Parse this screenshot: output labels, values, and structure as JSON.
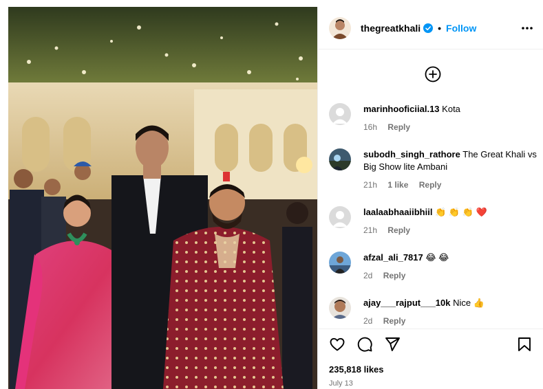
{
  "header": {
    "username": "thegreatkhali",
    "separator": "•",
    "follow_label": "Follow"
  },
  "icons": {
    "verified": "verified-badge-icon",
    "more": "more-options-icon",
    "load_more": "plus-circle-icon",
    "like": "heart-icon",
    "comment": "comment-bubble-icon",
    "share": "paper-plane-icon",
    "save": "bookmark-icon"
  },
  "colors": {
    "accent": "#0095f6",
    "verified": "#0095f6",
    "meta_text": "#737373",
    "divider": "#efefef"
  },
  "comments": [
    {
      "username": "marinhooficiial.13",
      "text": "Kota",
      "time": "16h",
      "likes": "",
      "reply": "Reply"
    },
    {
      "username": "subodh_singh_rathore",
      "text": "The Great Khali vs Big Show lite Ambani",
      "time": "21h",
      "likes": "1 like",
      "reply": "Reply"
    },
    {
      "username": "laalaabhaaiibhiil",
      "text": "👏 👏 👏 ❤️",
      "time": "21h",
      "likes": "",
      "reply": "Reply"
    },
    {
      "username": "afzal_ali_7817",
      "text": "😂 😂",
      "time": "2d",
      "likes": "",
      "reply": "Reply"
    },
    {
      "username": "ajay___rajput___10k",
      "text": "Nice 👍",
      "time": "2d",
      "likes": "",
      "reply": "Reply"
    }
  ],
  "footer": {
    "likes": "235,818 likes",
    "date": "July 13"
  }
}
